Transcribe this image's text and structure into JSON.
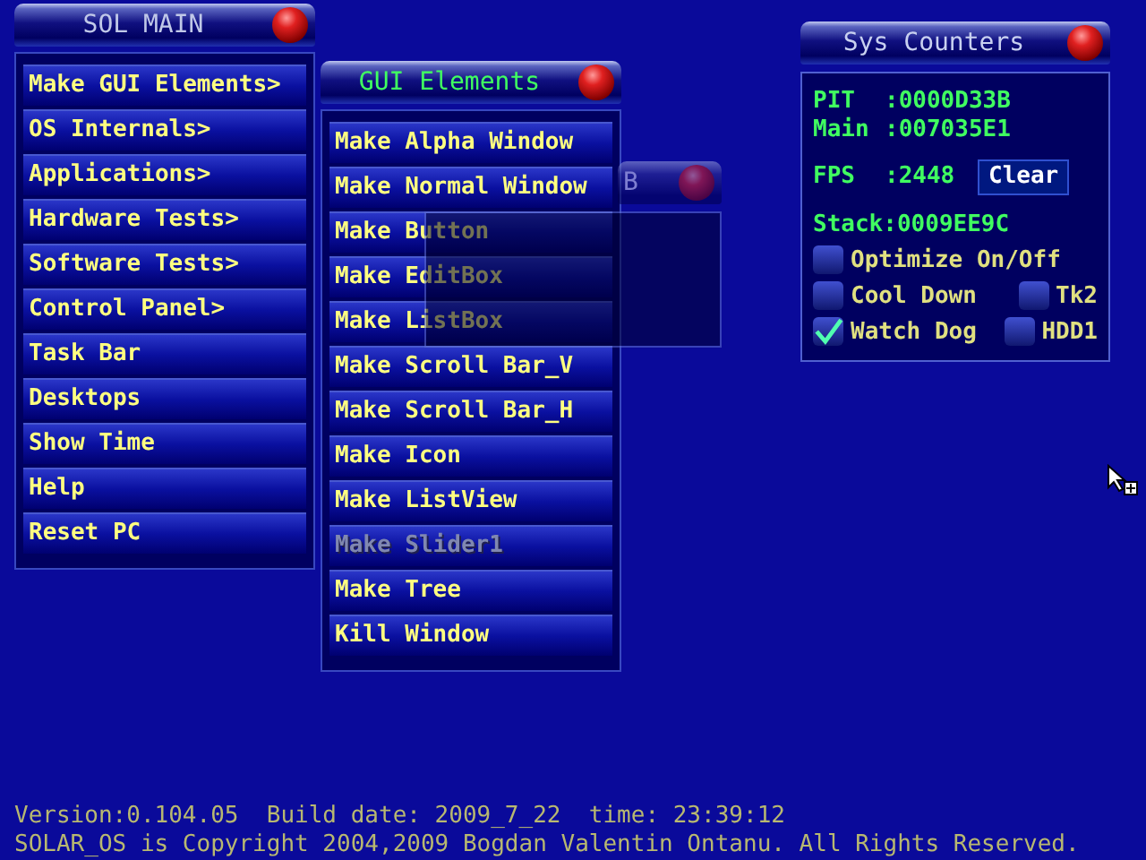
{
  "main_menu": {
    "title": "SOL MAIN",
    "items": [
      {
        "label": "Make GUI Elements>",
        "disabled": false
      },
      {
        "label": "OS Internals>",
        "disabled": false
      },
      {
        "label": "Applications>",
        "disabled": false
      },
      {
        "label": "Hardware Tests>",
        "disabled": false
      },
      {
        "label": "Software Tests>",
        "disabled": false
      },
      {
        "label": "Control Panel>",
        "disabled": false
      },
      {
        "label": "Task Bar",
        "disabled": false
      },
      {
        "label": "Desktops",
        "disabled": false
      },
      {
        "label": "Show Time",
        "disabled": false
      },
      {
        "label": "Help",
        "disabled": false
      },
      {
        "label": "Reset PC",
        "disabled": false
      }
    ]
  },
  "gui_menu": {
    "title": "GUI Elements",
    "items": [
      {
        "label": "Make Alpha Window",
        "disabled": false
      },
      {
        "label": "Make Normal Window",
        "disabled": false
      },
      {
        "label": "Make Button",
        "disabled": false
      },
      {
        "label": "Make EditBox",
        "disabled": false
      },
      {
        "label": "Make ListBox",
        "disabled": false
      },
      {
        "label": "Make Scroll Bar_V",
        "disabled": false
      },
      {
        "label": "Make Scroll Bar_H",
        "disabled": false
      },
      {
        "label": "Make Icon",
        "disabled": false
      },
      {
        "label": "Make ListView",
        "disabled": false
      },
      {
        "label": "Make Slider1",
        "disabled": true
      },
      {
        "label": "Make Tree",
        "disabled": false
      },
      {
        "label": "Kill Window",
        "disabled": false
      }
    ]
  },
  "alpha_window": {
    "title": "B"
  },
  "sys_counters": {
    "title": "Sys Counters",
    "counters": [
      {
        "label": "PIT",
        "value": ":0000D33B"
      },
      {
        "label": "Main",
        "value": ":007035E1"
      }
    ],
    "fps": {
      "label": "FPS",
      "value": ":2448"
    },
    "clear_button": "Clear",
    "stack": "Stack:0009EE9C",
    "option_rows": [
      [
        {
          "label": "Optimize On/Off",
          "checked": false
        }
      ],
      [
        {
          "label": "Cool Down",
          "checked": false
        },
        {
          "label": "Tk2",
          "checked": false
        }
      ],
      [
        {
          "label": "Watch Dog",
          "checked": true
        },
        {
          "label": "HDD1",
          "checked": false
        }
      ]
    ]
  },
  "footer": [
    "Version:0.104.05  Build date: 2009_7_22  time: 23:39:12",
    "SOLAR_OS is Copyright 2004,2009 Bogdan Valentin Ontanu. All Rights Reserved."
  ]
}
